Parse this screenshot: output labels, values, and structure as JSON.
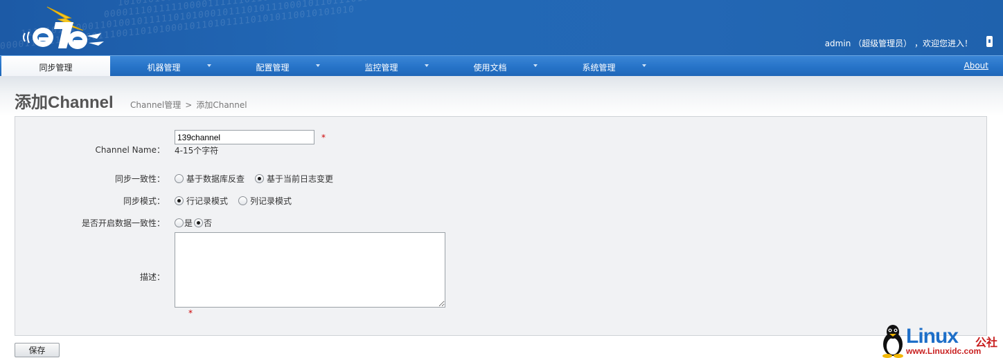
{
  "header": {
    "binary_lines": [
      "0011001011011110001010110101100110101001110100101",
      "1010101000011110110101100010111101110010101010110",
      "0000111011111000011111101101011101010110000111010111110000",
      "1110101010001101001011111010100010111010111000101101110101",
      "0000111111110000111001101010001011010111101010110010101010"
    ],
    "user_name": "admin",
    "user_role": "（超级管理员）",
    "welcome": "，欢迎您进入！",
    "logout_icon": "logout-icon"
  },
  "nav": {
    "items": [
      {
        "label": "同步管理",
        "active": true,
        "has_dropdown": false
      },
      {
        "label": "机器管理",
        "active": false,
        "has_dropdown": true
      },
      {
        "label": "配置管理",
        "active": false,
        "has_dropdown": true
      },
      {
        "label": "监控管理",
        "active": false,
        "has_dropdown": true
      },
      {
        "label": "使用文档",
        "active": false,
        "has_dropdown": true
      },
      {
        "label": "系统管理",
        "active": false,
        "has_dropdown": true
      }
    ],
    "about": "About"
  },
  "page": {
    "title": "添加Channel",
    "breadcrumb": {
      "parent": "Channel管理",
      "separator": ">",
      "current": "添加Channel"
    }
  },
  "form": {
    "channel_name": {
      "label": "Channel Name：",
      "value": "139channel",
      "hint": "4-15个字符",
      "required_mark": "*"
    },
    "sync_consistency": {
      "label": "同步一致性：",
      "options": [
        {
          "label": "基于数据库反查",
          "checked": false
        },
        {
          "label": "基于当前日志变更",
          "checked": true
        }
      ]
    },
    "sync_mode": {
      "label": "同步模式：",
      "options": [
        {
          "label": "行记录模式",
          "checked": true
        },
        {
          "label": "列记录模式",
          "checked": false
        }
      ]
    },
    "data_consistency": {
      "label": "是否开启数据一致性：",
      "options": [
        {
          "label": "是",
          "checked": false
        },
        {
          "label": "否",
          "checked": true
        }
      ]
    },
    "description": {
      "label": "描述：",
      "value": "",
      "required_mark": "*"
    }
  },
  "actions": {
    "save_label": "保存"
  },
  "watermark": {
    "brand": "Linux",
    "cn": "公社",
    "url": "www.Linuxidc.com"
  },
  "colors": {
    "header_blue": "#2268b6",
    "nav_blue": "#2673c8",
    "panel_bg": "#f1f2f4",
    "required_red": "#cc0000"
  }
}
